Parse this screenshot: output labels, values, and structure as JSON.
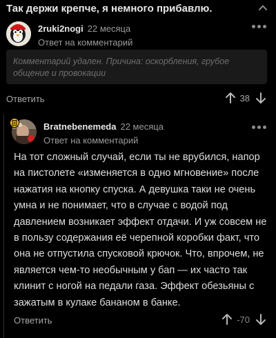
{
  "top_comment": {
    "text": "Так держи крепче, я немного прибавлю."
  },
  "comment1": {
    "author": "2ruki2nogi",
    "date": "22 месяца",
    "reply_label": "Ответ на комментарий",
    "deleted_text": "Комментарий удален. Причина: оскорбления, грубое общение и провокации",
    "reply_button": "Ответить",
    "rating": "38"
  },
  "comment2": {
    "author": "Bratnebenemeda",
    "date": "22 месяца",
    "reply_label": "Ответ на комментарий",
    "body": "На тот сложный случай, если ты не врубился, напор на пистолете «изменяется в одно мгновение» после нажатия на кнопку спуска. А девушка таки не очень умна и не понимает, что в случае с водой под давлением возникает эффект отдачи. И уж совсем не в пользу содержания её черепной коробки факт, что она не отпустила спусковой крючок. Что, впрочем, не является чем-то необычным у бап — их часто так клинит с ногой на педали газа. Эффект обезьяны с зажатым в кулаке бананом в банке.",
    "reply_button": "Ответить",
    "rating": "-70"
  },
  "colors": {
    "background": "#000000",
    "text": "#dedede",
    "muted": "#9a9a9a",
    "deleted_bg": "#1a1a1a",
    "badge": "#f5c400"
  },
  "icons": {
    "collapse": "chevron-up-icon",
    "more": "more-dots-icon",
    "upvote": "arrow-up-icon",
    "downvote": "arrow-down-icon",
    "badge": "document-badge-icon"
  }
}
